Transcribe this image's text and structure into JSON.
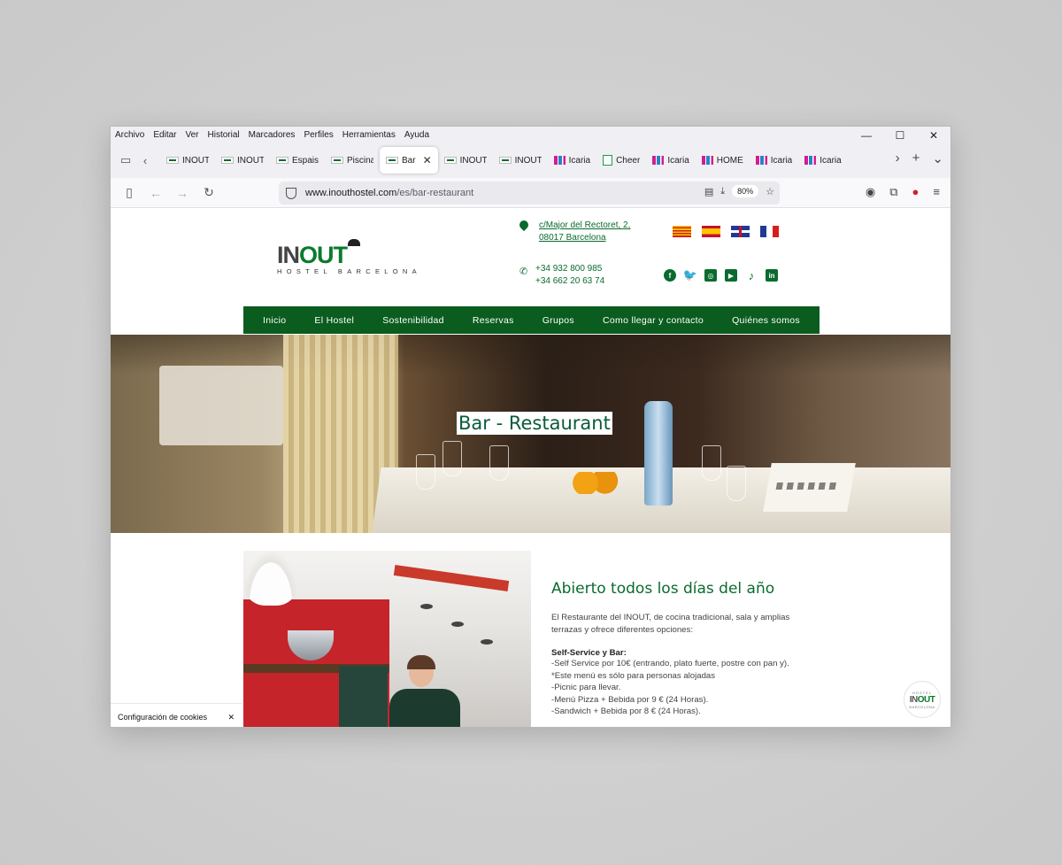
{
  "menubar": {
    "items": [
      "Archivo",
      "Editar",
      "Ver",
      "Historial",
      "Marcadores",
      "Perfiles",
      "Herramientas",
      "Ayuda"
    ]
  },
  "window_controls": {
    "minimize": "—",
    "maximize": "☐",
    "close": "✕"
  },
  "tabs": [
    {
      "label": "INOUT",
      "icon": "inout-favicon",
      "active": false
    },
    {
      "label": "INOUT",
      "icon": "inout-favicon",
      "active": false
    },
    {
      "label": "Espais",
      "icon": "inout-favicon",
      "active": false
    },
    {
      "label": "Piscina",
      "icon": "inout-favicon",
      "active": false
    },
    {
      "label": "Bar",
      "icon": "inout-favicon",
      "active": true
    },
    {
      "label": "INOUT",
      "icon": "inout-favicon",
      "active": false
    },
    {
      "label": "INOUT",
      "icon": "inout-favicon",
      "active": false
    },
    {
      "label": "Icaria",
      "icon": "icaria-favicon",
      "active": false
    },
    {
      "label": "Cheer",
      "icon": "cheer-favicon",
      "active": false
    },
    {
      "label": "Icaria",
      "icon": "icaria-favicon",
      "active": false
    },
    {
      "label": "HOME",
      "icon": "icaria-favicon",
      "active": false
    },
    {
      "label": "Icaria",
      "icon": "icaria-favicon",
      "active": false
    },
    {
      "label": "Icaria",
      "icon": "icaria-favicon",
      "active": false
    }
  ],
  "browser": {
    "url_host": "www.inouthostel.com",
    "url_path": "/es/bar-restaurant",
    "zoom": "80%"
  },
  "site": {
    "logo_in": "IN",
    "logo_out": "OUT",
    "logo_sub": "HOSTEL BARCELONA",
    "address_line1": "c/Major del Rectoret, 2,",
    "address_line2": "08017 Barcelona",
    "phone1": "+34 932 800 985",
    "phone2": "+34 662 20 63 74",
    "flags": [
      "catalan-flag",
      "spanish-flag",
      "uk-flag",
      "french-flag"
    ],
    "socials": [
      "facebook-icon",
      "twitter-icon",
      "instagram-icon",
      "youtube-icon",
      "tiktok-icon",
      "linkedin-icon"
    ],
    "nav": [
      "Inicio",
      "El Hostel",
      "Sostenibilidad",
      "Reservas",
      "Grupos",
      "Como llegar y contacto",
      "Quiénes somos"
    ],
    "hero_title": "Bar - Restaurant",
    "section_title": "Abierto todos los días del año",
    "intro": "El Restaurante del INOUT, de cocina tradicional, sala y amplias terrazas y ofrece diferentes opciones:",
    "subheading": "Self-Service y Bar:",
    "items": [
      "-Self Service por 10€ (entrando, plato fuerte, postre con pan y). *Este menú es sólo para personas alojadas",
      "-Picnic para llevar.",
      "-Menú Pizza + Bebida por 9 € (24 Horas).",
      "-Sandwich + Bebida por 8 € (24 Horas)."
    ],
    "cookie_label": "Configuración de cookies",
    "cookie_close": "✕",
    "badge_top": "HOSTEL",
    "badge_in": "IN",
    "badge_out": "OUT",
    "badge_bottom": "BARCELONA"
  },
  "colors": {
    "brand_green": "#0a5c1f",
    "text_green": "#0a6b2e"
  }
}
